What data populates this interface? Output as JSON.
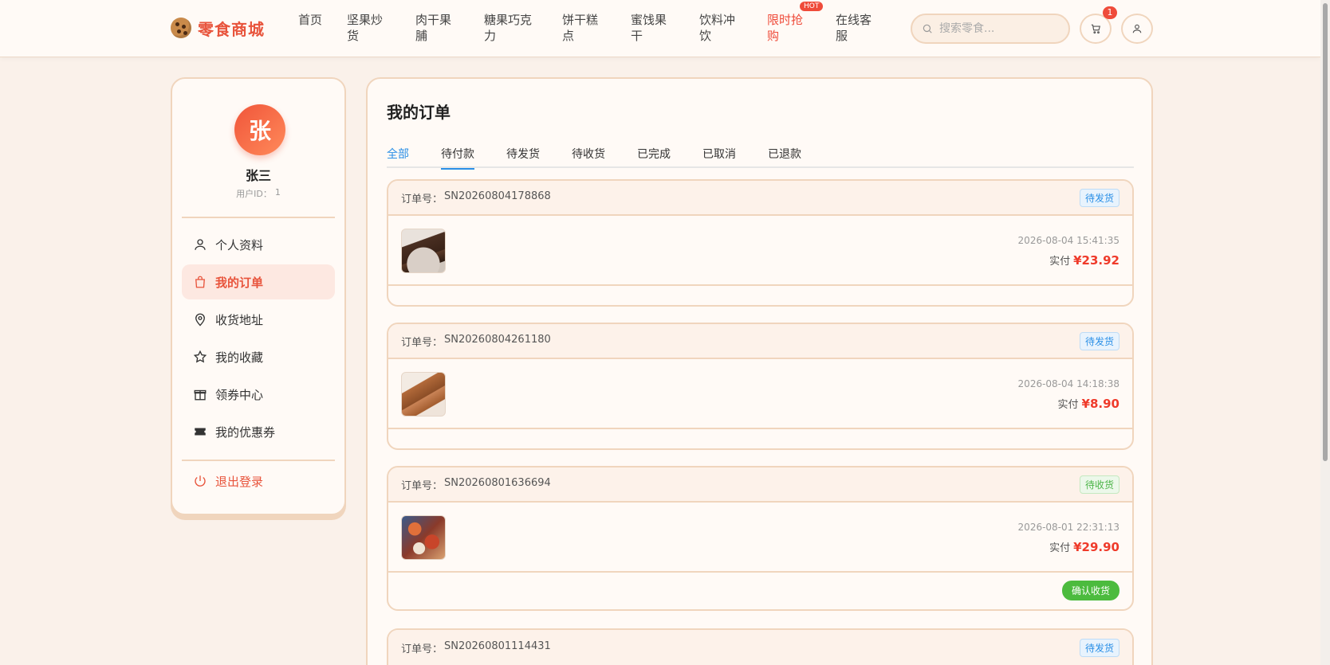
{
  "header": {
    "logo_text": "零食商城",
    "nav": [
      {
        "label": "首页"
      },
      {
        "label": "坚果炒货"
      },
      {
        "label": "肉干果脯"
      },
      {
        "label": "糖果巧克力"
      },
      {
        "label": "饼干糕点"
      },
      {
        "label": "蜜饯果干"
      },
      {
        "label": "饮料冲饮"
      },
      {
        "label": "限时抢购",
        "badge": "HOT"
      },
      {
        "label": "在线客服"
      }
    ],
    "search_placeholder": "搜索零食...",
    "cart_count": "1"
  },
  "sidebar": {
    "avatar_char": "张",
    "user_name": "张三",
    "user_id_label": "用户ID：",
    "user_id": "1",
    "menu": [
      {
        "label": "个人资料",
        "icon": "user-icon"
      },
      {
        "label": "我的订单",
        "icon": "shopping-bag-icon",
        "active": true
      },
      {
        "label": "收货地址",
        "icon": "location-pin-icon"
      },
      {
        "label": "我的收藏",
        "icon": "star-icon"
      },
      {
        "label": "领券中心",
        "icon": "gift-icon"
      },
      {
        "label": "我的优惠券",
        "icon": "ticket-icon"
      }
    ],
    "logout_label": "退出登录"
  },
  "main": {
    "title": "我的订单",
    "tabs": [
      "全部",
      "待付款",
      "待发货",
      "待收货",
      "已完成",
      "已取消",
      "已退款"
    ],
    "orders": [
      {
        "no_label": "订单号：",
        "no": "SN20260804178868",
        "status": "待发货",
        "status_color": "#2a8fe6",
        "time": "2026-08-04 15:41:35",
        "pay_label": "实付",
        "amount": "¥23.92"
      },
      {
        "no_label": "订单号：",
        "no": "SN20260804261180",
        "status": "待发货",
        "status_color": "#2a8fe6",
        "time": "2026-08-04 14:18:38",
        "pay_label": "实付",
        "amount": "¥8.90"
      },
      {
        "no_label": "订单号：",
        "no": "SN20260801636694",
        "status": "待收货",
        "status_color": "#4cb548",
        "time": "2026-08-01 22:31:13",
        "pay_label": "实付",
        "amount": "¥29.90",
        "action": "确认收货"
      },
      {
        "no_label": "订单号：",
        "no": "SN20260801114431",
        "status": "待发货",
        "status_color": "#2a8fe6"
      }
    ]
  },
  "colors": {
    "accent": "#e8543c",
    "link_blue": "#2a8fe6",
    "confirm_green": "#4cbb3e",
    "background": "#faf1ea"
  }
}
